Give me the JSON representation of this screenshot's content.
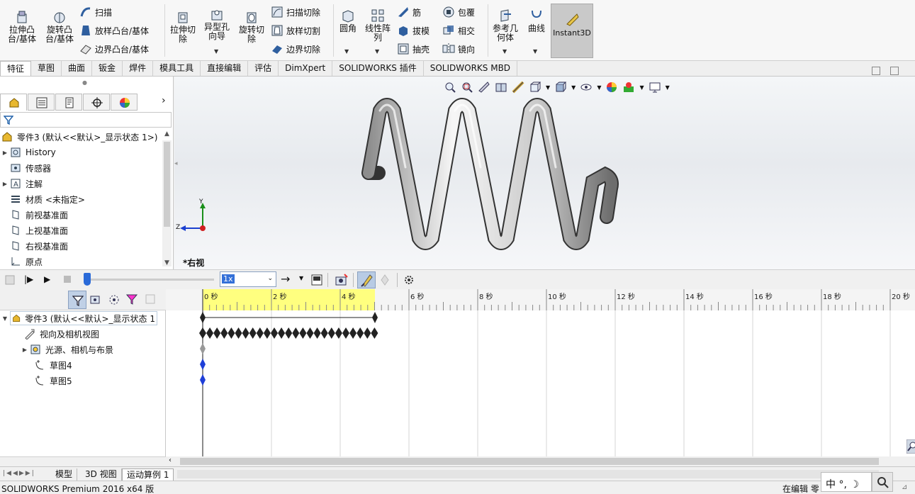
{
  "ribbon": {
    "extrude_boss": "拉伸凸\n台/基体",
    "revolve_boss": "旋转凸\n台/基体",
    "sweep": "扫描",
    "loft_boss": "放样凸台/基体",
    "boundary_boss": "边界凸台/基体",
    "extrude_cut": "拉伸切\n除",
    "hole_wizard": "异型孔\n向导",
    "revolve_cut": "旋转切\n除",
    "sweep_cut": "扫描切除",
    "loft_cut": "放样切割",
    "boundary_cut": "边界切除",
    "fillet": "圆角",
    "linear_pattern": "线性阵\n列",
    "rib": "筋",
    "draft": "拔模",
    "shell": "抽壳",
    "wrap": "包覆",
    "intersect": "相交",
    "mirror": "镜向",
    "ref_geometry": "参考几\n何体",
    "curves": "曲线",
    "instant3d": "Instant3D"
  },
  "tabs": [
    "特征",
    "草图",
    "曲面",
    "钣金",
    "焊件",
    "模具工具",
    "直接编辑",
    "评估",
    "DimXpert",
    "SOLIDWORKS 插件",
    "SOLIDWORKS MBD"
  ],
  "feature_tree": {
    "root": "零件3  (默认<<默认>_显示状态 1>)",
    "items": [
      "History",
      "传感器",
      "注解",
      "材质 <未指定>",
      "前视基准面",
      "上视基准面",
      "右视基准面",
      "原点"
    ]
  },
  "viewport": {
    "view_label": "*右视",
    "axis_y": "Y",
    "axis_z": "Z"
  },
  "motion_toolbar": {
    "speed_value": "1x"
  },
  "motion_tree": {
    "root": "零件3  (默认<<默认>_显示状态 1",
    "items": [
      "视向及相机视图",
      "光源、相机与布景",
      "草图4",
      "草图5"
    ]
  },
  "timeline": {
    "ticks": [
      "0 秒",
      "2 秒",
      "4 秒",
      "6 秒",
      "8 秒",
      "10 秒",
      "12 秒",
      "14 秒",
      "16 秒",
      "18 秒",
      "20 秒"
    ]
  },
  "bottom_tabs": [
    "模型",
    "3D 视图",
    "运动算例 1"
  ],
  "status": {
    "product": "SOLIDWORKS Premium 2016 x64 版",
    "editing": "在编辑 零",
    "ime": "中 °, ☽"
  },
  "colors": {
    "timeline_yellow": "#ffff7f",
    "key_blue": "#1f3fd8",
    "instant3d_bg": "#c9c9c9"
  }
}
